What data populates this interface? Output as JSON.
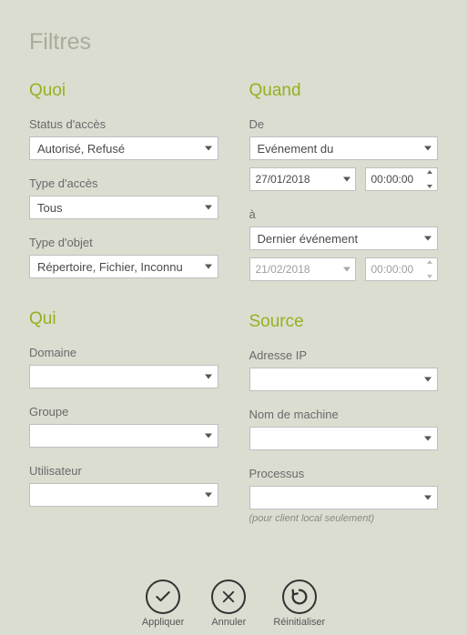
{
  "page_title": "Filtres",
  "sections": {
    "quoi": {
      "title": "Quoi",
      "status_label": "Status d'accès",
      "status_value": "Autorisé, Refusé",
      "type_access_label": "Type d'accès",
      "type_access_value": "Tous",
      "type_object_label": "Type d'objet",
      "type_object_value": "Répertoire, Fichier, Inconnu"
    },
    "quand": {
      "title": "Quand",
      "from_label": "De",
      "from_value": "Evénement du",
      "from_date": "27/01/2018",
      "from_time": "00:00:00",
      "to_label": "à",
      "to_value": "Dernier événement",
      "to_date": "21/02/2018",
      "to_time": "00:00:00"
    },
    "qui": {
      "title": "Qui",
      "domain_label": "Domaine",
      "domain_value": "",
      "group_label": "Groupe",
      "group_value": "",
      "user_label": "Utilisateur",
      "user_value": ""
    },
    "source": {
      "title": "Source",
      "ip_label": "Adresse IP",
      "ip_value": "",
      "machine_label": "Nom de machine",
      "machine_value": "",
      "process_label": "Processus",
      "process_value": "",
      "process_note": "(pour client local seulement)"
    }
  },
  "footer": {
    "apply": "Appliquer",
    "cancel": "Annuler",
    "reset": "Réinitialiser"
  }
}
